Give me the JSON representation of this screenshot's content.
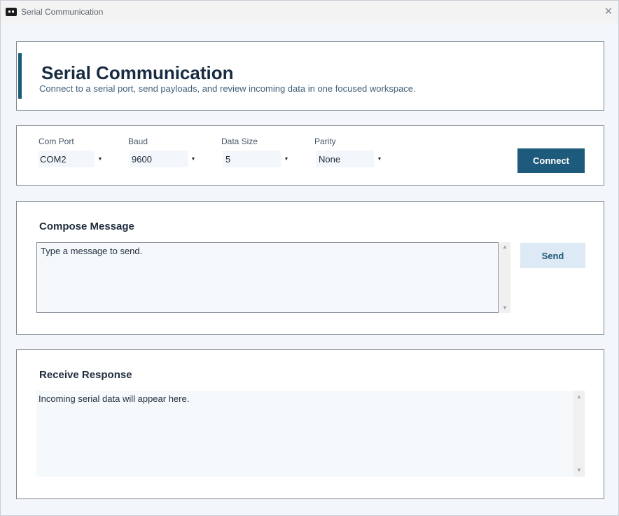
{
  "window": {
    "title": "Serial Communication",
    "close_glyph": "✕"
  },
  "header": {
    "title": "Serial Communication",
    "subtitle": "Connect to a serial port, send payloads, and review incoming data in one focused workspace."
  },
  "settings": {
    "com_port": {
      "label": "Com Port",
      "value": "COM2"
    },
    "baud": {
      "label": "Baud",
      "value": "9600"
    },
    "data_size": {
      "label": "Data Size",
      "value": "5"
    },
    "parity": {
      "label": "Parity",
      "value": "None"
    },
    "connect_label": "Connect"
  },
  "compose": {
    "title": "Compose Message",
    "value": "Type a message to send.",
    "send_label": "Send"
  },
  "receive": {
    "title": "Receive Response",
    "value": "Incoming serial data will appear here."
  },
  "colors": {
    "accent": "#1d5a7c",
    "send_bg": "#dde9f4"
  },
  "icons": {
    "arrow_down": "▼",
    "arrow_up": "▲"
  }
}
